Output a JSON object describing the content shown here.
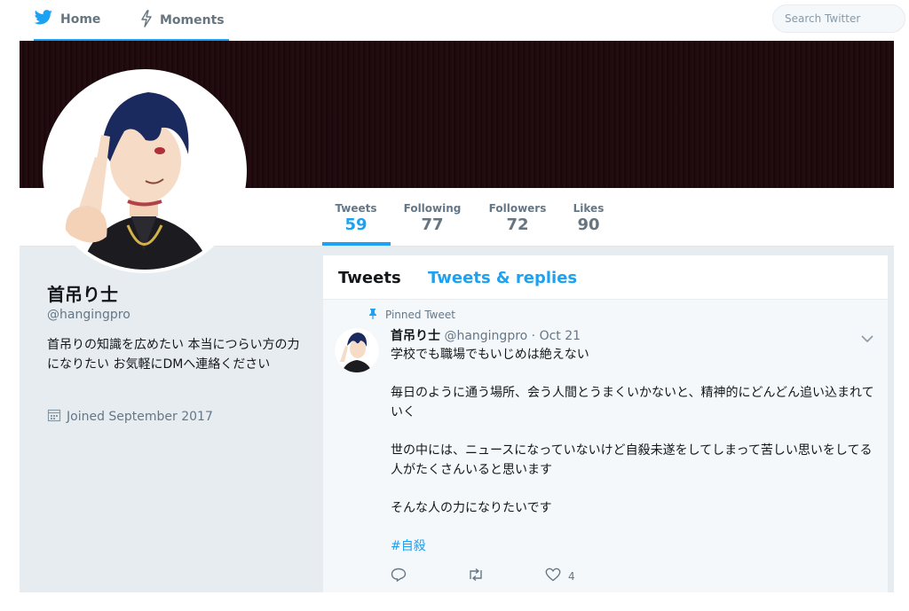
{
  "nav": {
    "home_label": "Home",
    "moments_label": "Moments",
    "search_placeholder": "Search Twitter"
  },
  "colors": {
    "accent": "#1da1f2",
    "page_bg": "#e6ecf0",
    "banner": "#1b0a0d"
  },
  "stats": [
    {
      "label": "Tweets",
      "value": "59",
      "active": true
    },
    {
      "label": "Following",
      "value": "77",
      "active": false
    },
    {
      "label": "Followers",
      "value": "72",
      "active": false
    },
    {
      "label": "Likes",
      "value": "90",
      "active": false
    }
  ],
  "profile": {
    "name": "首吊り士",
    "handle": "@hangingpro",
    "bio": "首吊りの知識を広めたい 本当につらい方の力になりたい お気軽にDMへ連絡ください",
    "joined": "Joined September 2017"
  },
  "timeline": {
    "tabs": [
      {
        "label": "Tweets",
        "active": true
      },
      {
        "label": "Tweets & replies",
        "active": false
      }
    ]
  },
  "tweet": {
    "pinned_label": "Pinned Tweet",
    "name": "首吊り士",
    "handle": "@hangingpro",
    "separator": "·",
    "date": "Oct 21",
    "paragraphs": [
      "学校でも職場でもいじめは絶えない",
      "毎日のように通う場所、会う人間とうまくいかないと、精神的にどんどん追い込まれていく",
      "世の中には、ニュースになっていないけど自殺未遂をしてしまって苦しい思いをしてる人がたくさんいると思います",
      "そんな人の力になりたいです"
    ],
    "hashtag": "#自殺",
    "likes": "4"
  },
  "icons": {
    "home": "bird-icon",
    "moments": "lightning-icon",
    "joined": "calendar-icon",
    "pinned": "pin-icon",
    "caret": "chevron-down-icon",
    "reply": "reply-icon",
    "retweet": "retweet-icon",
    "like": "heart-icon"
  }
}
